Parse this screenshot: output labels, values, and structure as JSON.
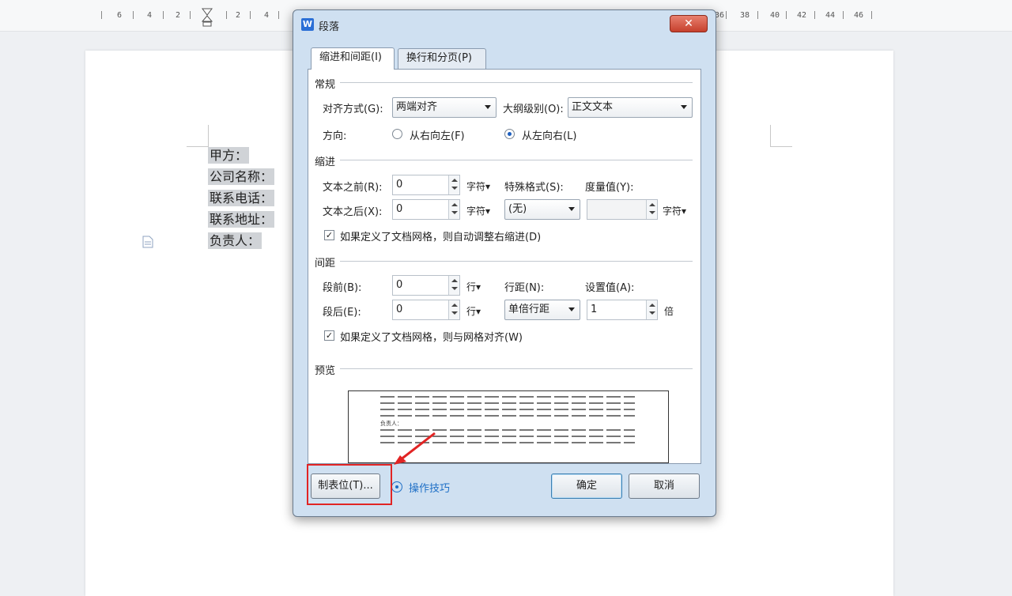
{
  "ruler": {
    "labels": [
      "6",
      "4",
      "2",
      "2",
      "4",
      "36",
      "38",
      "40",
      "42",
      "44",
      "46"
    ]
  },
  "document": {
    "lines": [
      "甲方：",
      "公司名称：",
      "联系电话：",
      "联系地址：",
      "负责人："
    ]
  },
  "dialog": {
    "app_icon_letter": "W",
    "title": "段落",
    "close_symbol": "✕",
    "tabs": [
      "缩进和间距(I)",
      "换行和分页(P)"
    ],
    "general": {
      "section": "常规",
      "align_label": "对齐方式(G):",
      "align_value": "两端对齐",
      "outline_label": "大纲级别(O):",
      "outline_value": "正文文本",
      "direction_label": "方向:",
      "rtl_label": "从右向左(F)",
      "ltr_label": "从左向右(L)"
    },
    "indent": {
      "section": "缩进",
      "before_label": "文本之前(R):",
      "before_value": "0",
      "before_unit": "字符▾",
      "after_label": "文本之后(X):",
      "after_value": "0",
      "after_unit": "字符▾",
      "special_label": "特殊格式(S):",
      "special_value": "(无)",
      "measure_label": "度量值(Y):",
      "measure_value": "",
      "measure_unit": "字符▾",
      "grid_check_label": "如果定义了文档网格，则自动调整右缩进(D)"
    },
    "spacing": {
      "section": "间距",
      "before_label": "段前(B):",
      "before_value": "0",
      "before_unit": "行▾",
      "after_label": "段后(E):",
      "after_value": "0",
      "after_unit": "行▾",
      "line_label": "行距(N):",
      "line_value": "单倍行距",
      "setting_label": "设置值(A):",
      "setting_value": "1",
      "setting_unit": "倍",
      "grid_check_label": "如果定义了文档网格，则与网格对齐(W)"
    },
    "preview": {
      "section": "预览",
      "sample_text": "负责人："
    },
    "buttons": {
      "tabs_button": "制表位(T)...",
      "tips_link": "操作技巧",
      "ok": "确定",
      "cancel": "取消"
    }
  },
  "colors": {
    "highlight": "#e12424",
    "link": "#1e6fc6",
    "dialog_frame": "#cfe0f1"
  }
}
